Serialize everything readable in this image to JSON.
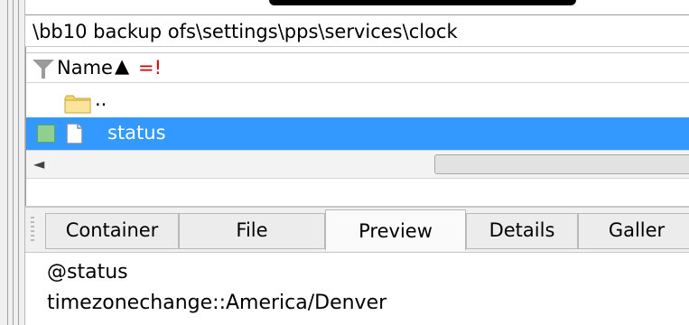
{
  "path": "\\bb10 backup ofs\\settings\\pps\\services\\clock",
  "header": {
    "name_label": "Name",
    "sort_arrow": "▲",
    "flag": "=!"
  },
  "rows": [
    {
      "label": ".."
    },
    {
      "label": "status"
    }
  ],
  "scroll": {
    "left_arrow": "◄"
  },
  "tabs": [
    {
      "label": "Container"
    },
    {
      "label": "File"
    },
    {
      "label": "Preview"
    },
    {
      "label": "Details"
    },
    {
      "label": "Galler"
    }
  ],
  "active_tab": "Preview",
  "preview": {
    "lines": [
      "@status",
      "timezonechange::America/Denver"
    ]
  },
  "colors": {
    "selection": "#3399ff",
    "folder": "#f5d66b",
    "check": "#8fd08f",
    "flag": "#d40000"
  }
}
